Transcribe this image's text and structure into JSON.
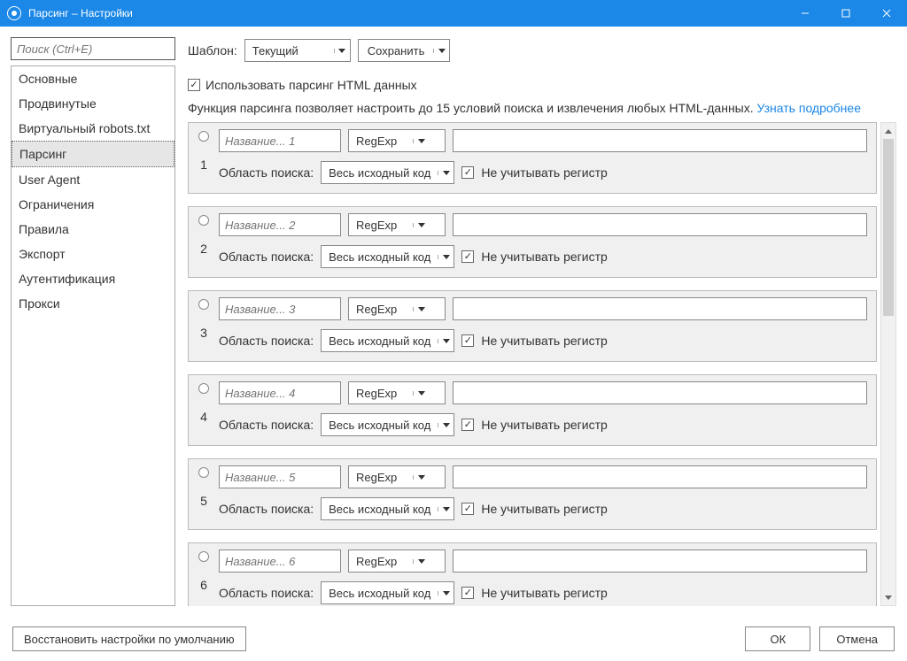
{
  "window": {
    "title": "Парсинг – Настройки"
  },
  "sidebar": {
    "search_placeholder": "Поиск (Ctrl+E)",
    "items": [
      {
        "label": "Основные"
      },
      {
        "label": "Продвинутые"
      },
      {
        "label": "Виртуальный robots.txt"
      },
      {
        "label": "Парсинг"
      },
      {
        "label": "User Agent"
      },
      {
        "label": "Ограничения"
      },
      {
        "label": "Правила"
      },
      {
        "label": "Экспорт"
      },
      {
        "label": "Аутентификация"
      },
      {
        "label": "Прокси"
      }
    ],
    "selected_index": 3
  },
  "top": {
    "template_label": "Шаблон:",
    "template_value": "Текущий",
    "save_label": "Сохранить"
  },
  "enable": {
    "checked": true,
    "label": "Использовать парсинг HTML данных"
  },
  "description": {
    "text": "Функция парсинга позволяет настроить до 15 условий поиска и извлечения любых HTML-данных. ",
    "link": "Узнать подробнее"
  },
  "rule_labels": {
    "scope_label": "Область поиска:",
    "scope_value": "Весь исходный код",
    "ignorecase_label": "Не учитывать регистр",
    "regex_value": "RegExp",
    "name_prefix": "Название..."
  },
  "rules": [
    {
      "n": "1",
      "name_ph": "Название... 1"
    },
    {
      "n": "2",
      "name_ph": "Название... 2"
    },
    {
      "n": "3",
      "name_ph": "Название... 3"
    },
    {
      "n": "4",
      "name_ph": "Название... 4"
    },
    {
      "n": "5",
      "name_ph": "Название... 5"
    },
    {
      "n": "6",
      "name_ph": "Название... 6"
    }
  ],
  "footer": {
    "restore": "Восстановить настройки по умолчанию",
    "ok": "ОК",
    "cancel": "Отмена"
  }
}
